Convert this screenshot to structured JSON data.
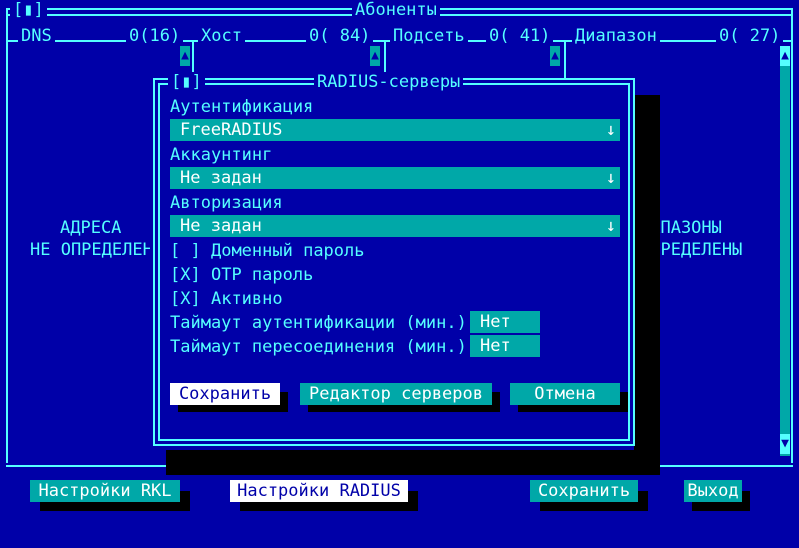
{
  "window": {
    "title": "Абоненты",
    "close_glyph": "[▮]"
  },
  "columns": [
    {
      "label": "DNS",
      "count": "0(16)"
    },
    {
      "label": "Хост",
      "count": "0( 84)"
    },
    {
      "label": "Подсеть",
      "count": "0( 41)"
    },
    {
      "label": "Диапазон",
      "count": "0( 27)"
    }
  ],
  "left_message": {
    "line1": "АДРЕСА",
    "line2": "НЕ ОПРЕДЕЛЕН"
  },
  "right_message": {
    "line1": "ИАПАЗОНЫ",
    "line2": "ОПРЕДЕЛЕНЫ"
  },
  "scroll": {
    "up": "▲",
    "down": "▼"
  },
  "dialog": {
    "title": "RADIUS-серверы",
    "close_glyph": "[▮]",
    "auth_label": "Аутентификация",
    "auth_value": "FreeRADIUS",
    "accounting_label": "Аккаунтинг",
    "accounting_value": "Не задан",
    "authorization_label": "Авторизация",
    "authorization_value": "Не задан",
    "dropdown_arrow": "↓",
    "domain_password": {
      "mark": "[ ]",
      "label": "Доменный пароль"
    },
    "otp_password": {
      "mark": "[X]",
      "label": "OTP пароль"
    },
    "active": {
      "mark": "[X]",
      "label": "Активно"
    },
    "auth_timeout_label": "Таймаут аутентификации (мин.):",
    "auth_timeout_value": "Нет",
    "reconnect_timeout_label": "Таймаут пересоединения (мин.):",
    "reconnect_timeout_value": "Нет",
    "save_button": "Сохранить",
    "editor_button": "Редактор серверов",
    "cancel_button": "Отмена"
  },
  "bottom_buttons": {
    "rkl": "Настройки RKL",
    "radius": "Настройки RADIUS",
    "save": "Сохранить",
    "exit": "Выход"
  },
  "colors": {
    "background": "#0000a8",
    "frame": "#55ffff",
    "dialog": "#00a8a8",
    "text": "#55ffff",
    "highlight": "#ffffff"
  }
}
